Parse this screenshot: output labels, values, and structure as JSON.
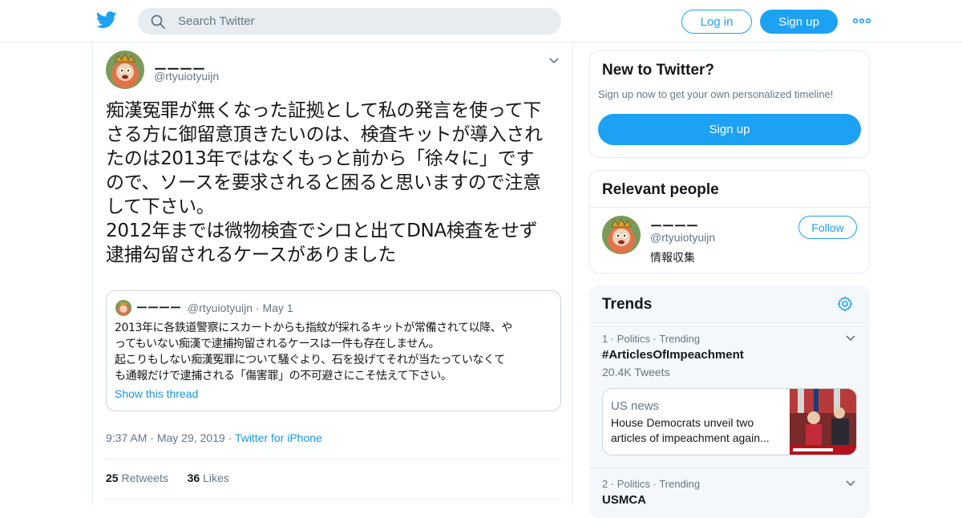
{
  "header": {
    "search_placeholder": "Search Twitter",
    "login_label": "Log in",
    "signup_label": "Sign up",
    "more_icon": "more-dots-icon",
    "logo_icon": "twitter-bird-icon"
  },
  "tweet": {
    "author_name": "ーーーー",
    "author_handle": "@rtyuiotyuijn",
    "text": "痴漢冤罪が無くなった証拠として私の発言を使って下\nさる方に御留意頂きたいのは、検査キットが導入され\nたのは2013年ではなくもっと前から「徐々に」です\nので、ソースを要求されると困ると思いますので注意\nして下さい。\n2012年までは微物検査でシロと出てDNA検査をせず\n逮捕勾留されるケースがありました",
    "quote": {
      "author_name": "ーーーー",
      "author_handle": "@rtyuiotyuijn",
      "date": "May 1",
      "text": "2013年に各鉄道警察にスカートからも指紋が採れるキットが常備されて以降、や\nってもいない痴漢で逮捕拘留されるケースは一件も存在しません。\n起こりもしない痴漢冤罪について騒ぐより、石を投げてそれが当たっていなくて\nも通報だけで逮捕される「傷害罪」の不可避さにこそ怯えて下さい。",
      "show_thread": "Show this thread"
    },
    "time": "9:37 AM",
    "date": "May 29, 2019",
    "source": "Twitter for iPhone",
    "retweets_count": "25",
    "retweets_label": "Retweets",
    "likes_count": "36",
    "likes_label": "Likes"
  },
  "sidebar": {
    "new_card": {
      "title": "New to Twitter?",
      "subtitle": "Sign up now to get your own personalized timeline!",
      "button": "Sign up"
    },
    "people_card": {
      "title": "Relevant people",
      "name": "ーーーー",
      "handle": "@rtyuiotyuijn",
      "bio": "情報収集",
      "follow_label": "Follow"
    },
    "trends_card": {
      "title": "Trends",
      "items": [
        {
          "rank": "1",
          "category": "Politics",
          "status": "Trending",
          "name": "#ArticlesOfImpeachment",
          "count": "20.4K Tweets"
        },
        {
          "rank": "2",
          "category": "Politics",
          "status": "Trending",
          "name": "USMCA"
        }
      ],
      "news": {
        "category": "US news",
        "headline": "House Democrats unveil two articles of impeachment again..."
      }
    }
  },
  "colors": {
    "accent": "#1da1f2",
    "link": "#1b95e0",
    "muted": "#657786",
    "border": "#e6ecf0"
  }
}
